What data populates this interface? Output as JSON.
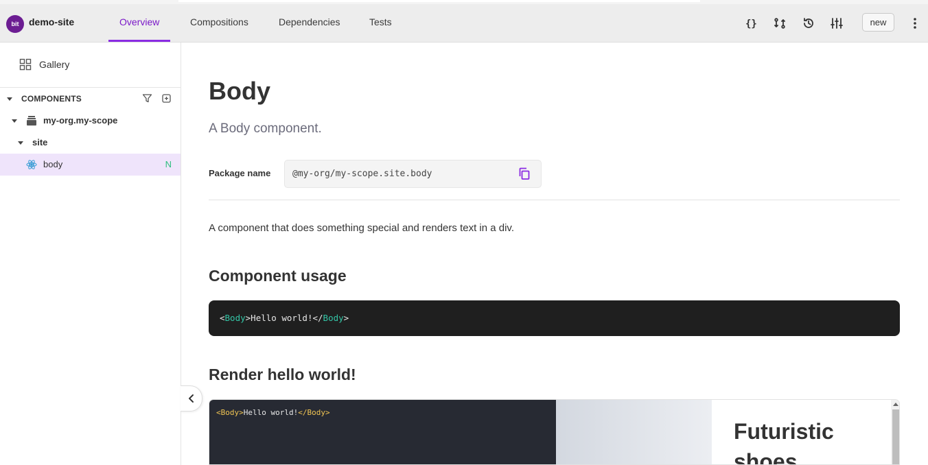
{
  "header": {
    "scope_logo": "bit",
    "scope_name": "demo-site",
    "tabs": [
      {
        "label": "Overview",
        "active": true
      },
      {
        "label": "Compositions",
        "active": false
      },
      {
        "label": "Dependencies",
        "active": false
      },
      {
        "label": "Tests",
        "active": false
      }
    ],
    "icons": [
      "code-braces-icon",
      "compare-icon",
      "history-icon",
      "settings-sliders-icon",
      "more-vertical-icon"
    ],
    "new_label": "new"
  },
  "sidebar": {
    "gallery_label": "Gallery",
    "components_label": "COMPONENTS",
    "tree": {
      "scope": "my-org.my-scope",
      "namespace": "site",
      "component": "body",
      "component_badge": "N"
    }
  },
  "main": {
    "title": "Body",
    "subtitle": "A Body component.",
    "package_label": "Package name",
    "package_value": "@my-org/my-scope.site.body",
    "description": "A component that does something special and renders text in a div.",
    "usage_heading": "Component usage",
    "usage_code": {
      "open_lt": "<",
      "tag": "Body",
      "open_gt": ">",
      "text": "Hello world!",
      "close_lt": "</",
      "close_gt": ">"
    },
    "render_heading": "Render hello world!",
    "live_preview_title": "Futuristic shoes"
  },
  "colors": {
    "accent": "#8a2be2",
    "logo_bg": "#6c1d92",
    "new_badge": "#2dbf7e",
    "code_bg": "#1f1f1f"
  }
}
